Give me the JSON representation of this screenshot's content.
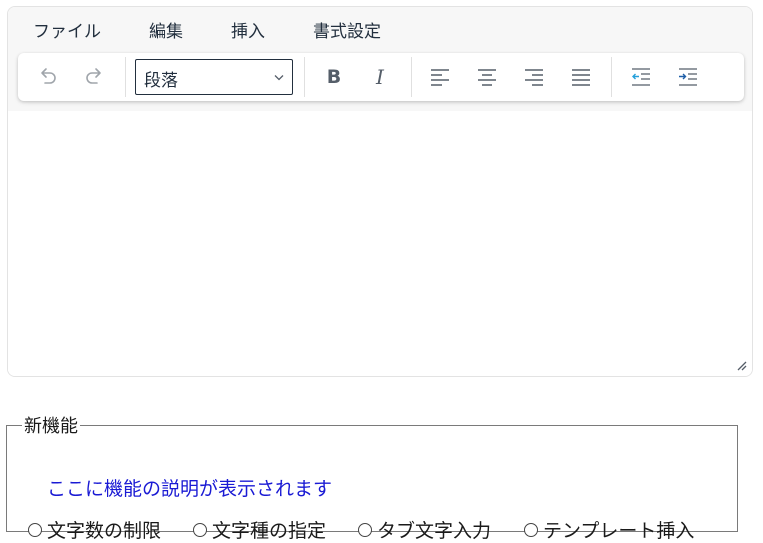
{
  "menubar": {
    "items": [
      "ファイル",
      "編集",
      "挿入",
      "書式設定"
    ]
  },
  "toolbar": {
    "format_select": {
      "selected": "段落"
    },
    "icons": {
      "undo": "undo-icon",
      "redo": "redo-icon",
      "bold": "B",
      "italic": "I",
      "align_left": "align-left-icon",
      "align_center": "align-center-icon",
      "align_right": "align-right-icon",
      "align_justify": "align-justify-icon",
      "outdent": "outdent-icon",
      "indent": "indent-icon"
    }
  },
  "editor": {
    "content": ""
  },
  "feature_panel": {
    "legend": "新機能",
    "description": "ここに機能の説明が表示されます",
    "options": [
      "文字数の制限",
      "文字種の指定",
      "タブ文字入力",
      "テンプレート挿入"
    ]
  },
  "colors": {
    "description_text": "#1a1ad4",
    "toolbar_icon": "#555e69",
    "outdent_accent": "#26a0da",
    "indent_accent": "#1f5fa8"
  }
}
